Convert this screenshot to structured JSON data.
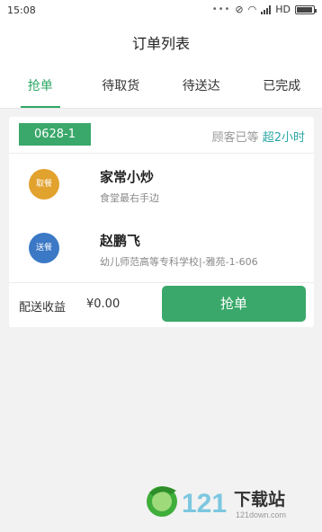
{
  "status": {
    "time": "15:08",
    "net": "HD"
  },
  "header": {
    "title": "订单列表"
  },
  "tabs": [
    {
      "label": "抢单",
      "active": true
    },
    {
      "label": "待取货",
      "active": false
    },
    {
      "label": "待送达",
      "active": false
    },
    {
      "label": "已完成",
      "active": false
    }
  ],
  "order": {
    "number": "0628-1",
    "wait_prefix": "顾客已等",
    "wait_highlight": "超2小时",
    "pickup": {
      "badge": "取餐",
      "name": "家常小炒",
      "address": "食堂最右手边"
    },
    "delivery": {
      "badge": "送餐",
      "name": "赵鹏飞",
      "address": "幼儿师范高等专科学校|-雅苑-1-606"
    },
    "earn_label": "配送收益",
    "earn_value": "¥0.00",
    "grab_label": "抢单"
  },
  "watermark": {
    "number": "121",
    "brand": "下载站",
    "url": "121down.com"
  },
  "colors": {
    "accent": "#2fa866",
    "button": "#3aa86a",
    "highlight": "#2aa6a6",
    "pickup_badge": "#e2a22e",
    "delivery_badge": "#3b78c6"
  }
}
